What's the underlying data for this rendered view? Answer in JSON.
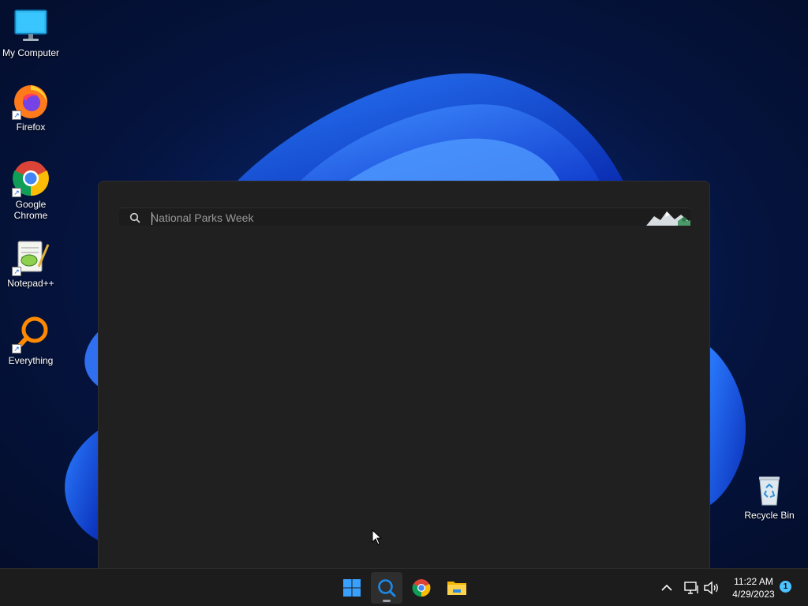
{
  "desktop": {
    "icons": [
      {
        "label": "My Computer",
        "icon": "monitor-icon"
      },
      {
        "label": "Firefox",
        "icon": "firefox-icon"
      },
      {
        "label": "Google Chrome",
        "icon": "chrome-icon"
      },
      {
        "label": "Notepad++",
        "icon": "notepad-plus-plus-icon"
      },
      {
        "label": "Everything",
        "icon": "everything-search-icon"
      }
    ],
    "recycle_bin": {
      "label": "Recycle Bin",
      "icon": "recycle-bin-icon"
    }
  },
  "search_panel": {
    "search_input": {
      "value": "",
      "placeholder": "National Parks Week"
    },
    "search_icon": "magnifier-icon",
    "highlight_image": "mountain-illustration-icon"
  },
  "taskbar": {
    "apps": [
      {
        "name": "Start",
        "icon": "windows-start-icon",
        "active": false
      },
      {
        "name": "Search",
        "icon": "search-icon",
        "active": true
      },
      {
        "name": "Google Chrome",
        "icon": "chrome-icon",
        "active": false
      },
      {
        "name": "File Explorer",
        "icon": "folder-icon",
        "active": false
      }
    ],
    "tray": {
      "overflow_icon": "chevron-up-icon",
      "network_icon": "network-icon",
      "volume_icon": "volume-icon",
      "time": "11:22 AM",
      "date": "4/29/2023",
      "notification_count": "1"
    }
  },
  "colors": {
    "accent": "#4cc2ff",
    "panel_bg": "#202020",
    "taskbar_bg": "#1c1c1c",
    "wallpaper_blue": "#1f5fe8"
  }
}
